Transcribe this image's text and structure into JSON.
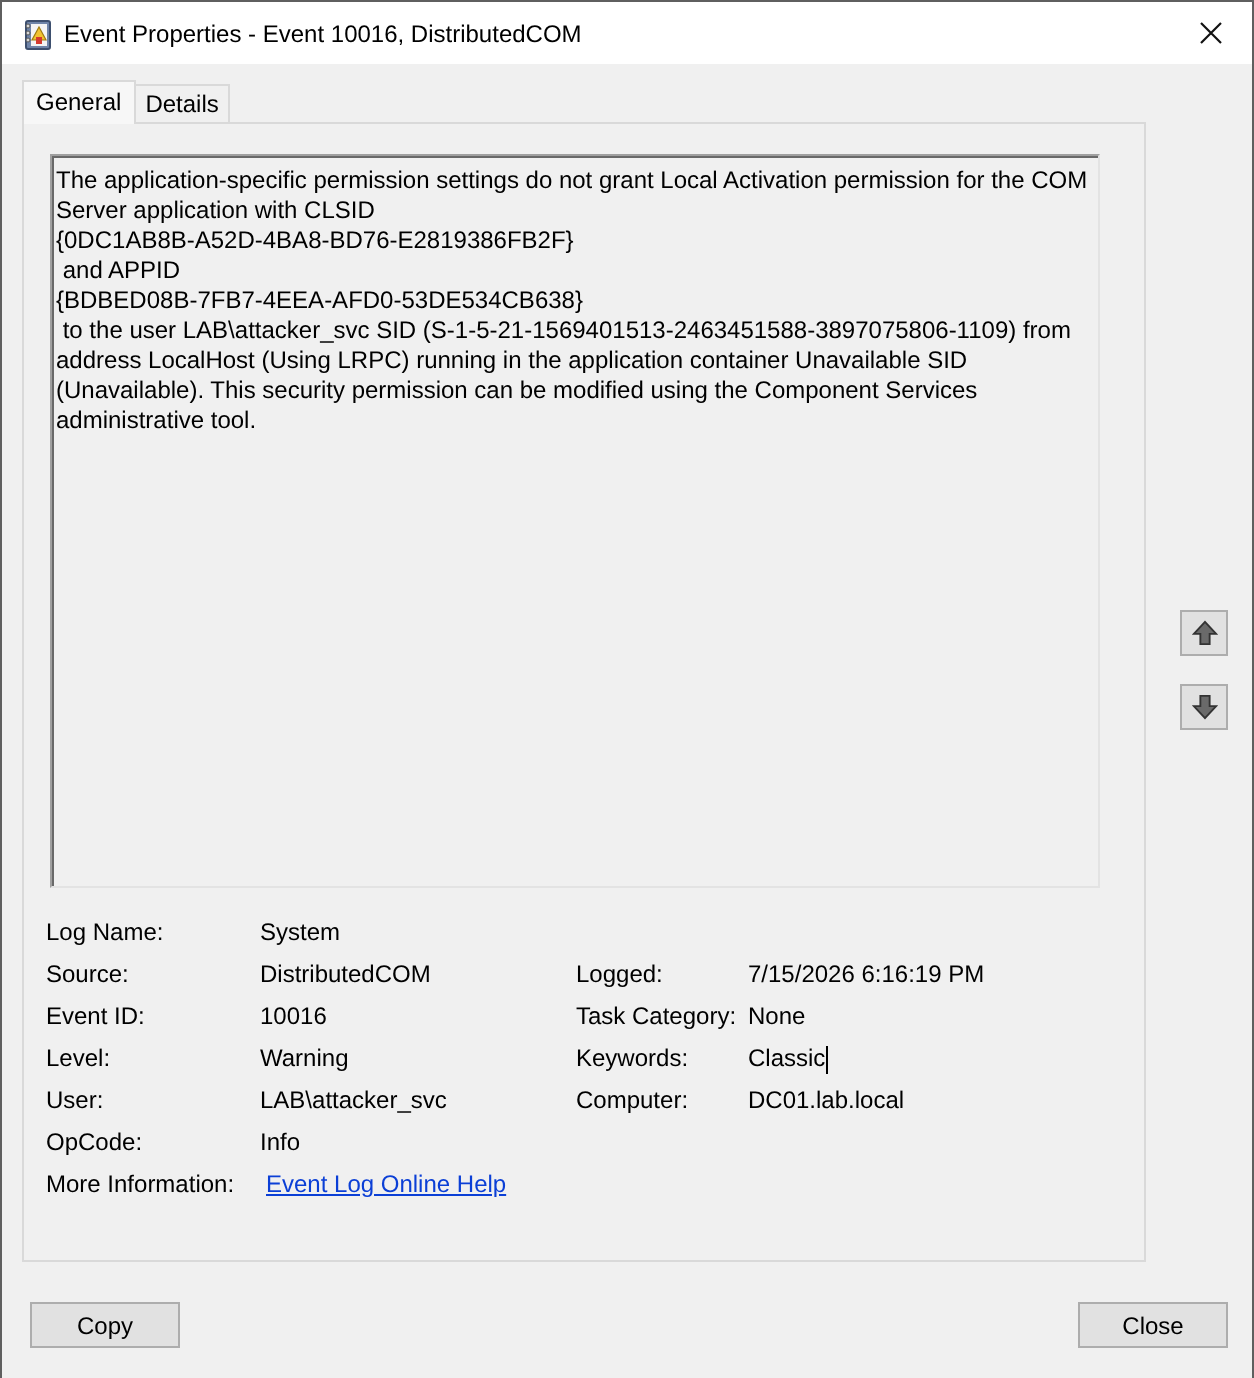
{
  "window": {
    "title": "Event Properties - Event 10016, DistributedCOM"
  },
  "tabs": [
    {
      "label": "General",
      "selected": true
    },
    {
      "label": "Details",
      "selected": false
    }
  ],
  "description": "The application-specific permission settings do not grant Local Activation permission for the COM Server application with CLSID\n{0DC1AB8B-A52D-4BA8-BD76-E2819386FB2F}\n and APPID\n{BDBED08B-7FB7-4EEA-AFD0-53DE534CB638}\n to the user LAB\\attacker_svc SID (S-1-5-21-1569401513-2463451588-3897075806-1109) from address LocalHost (Using LRPC) running in the application container Unavailable SID (Unavailable). This security permission can be modified using the Component Services administrative tool.",
  "details": {
    "rows": [
      {
        "left": {
          "label": "Log Name:",
          "value": "System",
          "kind": "text",
          "focused": false
        }
      },
      {
        "left": {
          "label": "Source:",
          "value": "DistributedCOM",
          "kind": "text",
          "focused": false
        },
        "right": {
          "label": "Logged:",
          "value": "7/15/2026 6:16:19 PM",
          "kind": "text",
          "focused": false
        }
      },
      {
        "left": {
          "label": "Event ID:",
          "value": "10016",
          "kind": "text",
          "focused": false
        },
        "right": {
          "label": "Task Category:",
          "value": "None",
          "kind": "text",
          "focused": false
        }
      },
      {
        "left": {
          "label": "Level:",
          "value": "Warning",
          "kind": "text",
          "focused": false
        },
        "right": {
          "label": "Keywords:",
          "value": "Classic",
          "kind": "text",
          "focused": true
        }
      },
      {
        "left": {
          "label": "User:",
          "value": "LAB\\attacker_svc",
          "kind": "text",
          "focused": false
        },
        "right": {
          "label": "Computer:",
          "value": "DC01.lab.local",
          "kind": "text",
          "focused": false
        }
      },
      {
        "left": {
          "label": "OpCode:",
          "value": "Info",
          "kind": "text",
          "focused": false
        }
      },
      {
        "left": {
          "label": "More Information:",
          "value": "Event Log Online Help",
          "kind": "link",
          "focused": false
        }
      }
    ]
  },
  "buttons": [
    {
      "label": "Copy"
    },
    {
      "label": "Close"
    }
  ]
}
